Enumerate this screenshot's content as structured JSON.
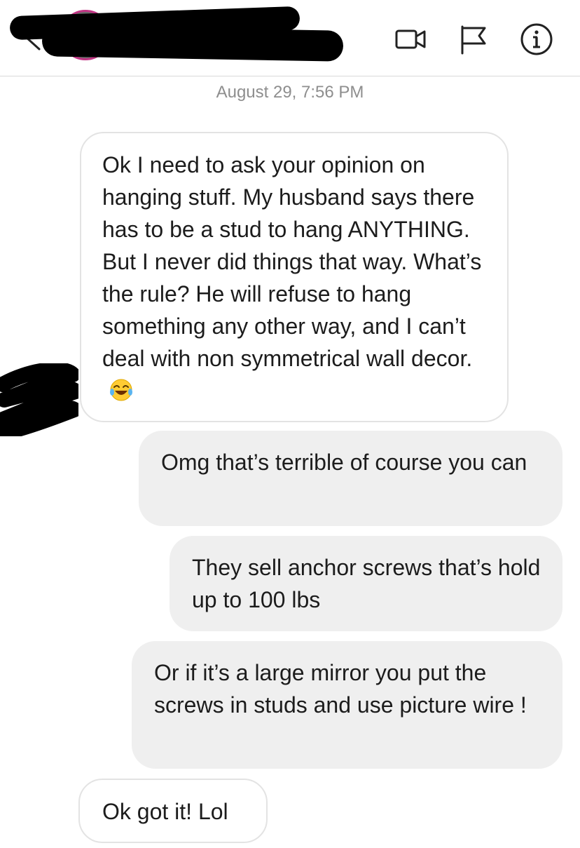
{
  "header": {
    "icons": [
      "back-chevron-icon",
      "video-call-icon",
      "flag-icon",
      "info-icon"
    ]
  },
  "thread": {
    "timestamp": "August 29, 7:56 PM",
    "messages": [
      {
        "direction": "incoming",
        "text": "Ok I need to ask your opinion on hanging stuff. My husband says there has to be a stud to hang ANYTHING. But I never did things that way. What’s the rule? He will refuse to hang something any other way, and I can’t deal with non symmetrical wall decor.",
        "emoji": "face-with-tears-of-joy"
      },
      {
        "direction": "outgoing",
        "text": "Omg that’s terrible of course you can"
      },
      {
        "direction": "outgoing",
        "text": "They sell anchor screws that’s hold up to 100 lbs"
      },
      {
        "direction": "outgoing",
        "text": "Or if it’s a large mirror you put the screws in studs and use picture wire !"
      },
      {
        "direction": "incoming",
        "text": "Ok got it! Lol"
      }
    ]
  },
  "colors": {
    "incoming_bubble_bg": "#ffffff",
    "incoming_bubble_border": "#e3e3e3",
    "outgoing_bubble_bg": "#efefef",
    "timestamp": "#8e8e8e",
    "text": "#1c1c1c",
    "avatar_ring": "#c13584"
  }
}
